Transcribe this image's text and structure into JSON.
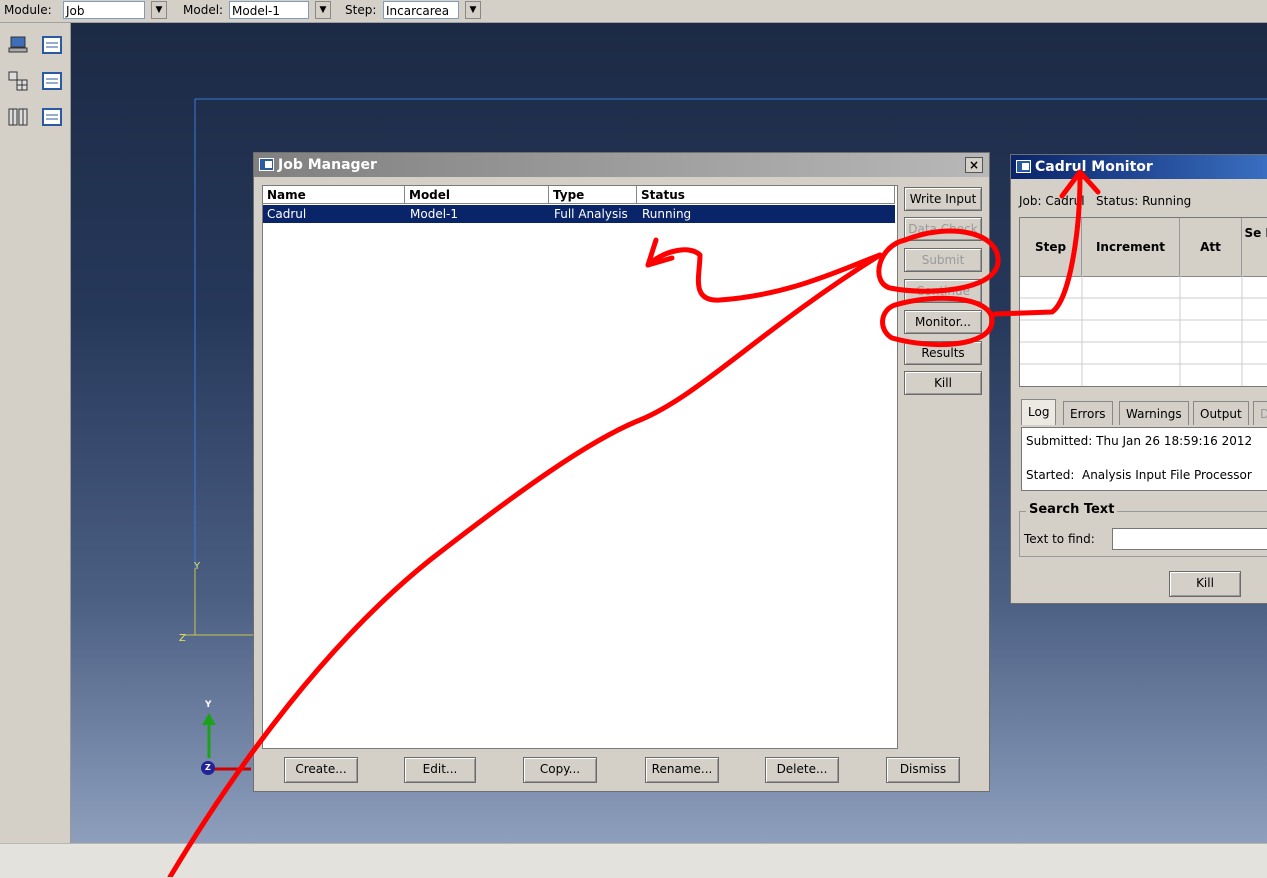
{
  "toolbar": {
    "module_label": "Module:",
    "module_value": "Job",
    "model_label": "Model:",
    "model_value": "Model-1",
    "step_label": "Step:",
    "step_value": "Incarcarea"
  },
  "viewport": {
    "csys_y": "Y",
    "csys_z": "Z",
    "triad_y": "Y",
    "triad_z": "Z"
  },
  "job_manager": {
    "title": "Job Manager",
    "close": "×",
    "columns": [
      "Name",
      "Model",
      "Type",
      "Status"
    ],
    "rows": [
      {
        "name": "Cadrul",
        "model": "Model-1",
        "type": "Full Analysis",
        "status": "Running"
      }
    ],
    "side_buttons": {
      "write_input": "Write Input",
      "data_check": "Data Check",
      "submit": "Submit",
      "continue": "Continue",
      "monitor": "Monitor...",
      "results": "Results",
      "kill": "Kill"
    },
    "bottom_buttons": {
      "create": "Create...",
      "edit": "Edit...",
      "copy": "Copy...",
      "rename": "Rename...",
      "delete": "Delete...",
      "dismiss": "Dismiss"
    }
  },
  "monitor": {
    "title": "Cadrul Monitor",
    "job_line": "Job: Cadrul   Status: Running",
    "columns": [
      "Step",
      "Increment",
      "Att",
      "Se Di"
    ],
    "tabs": [
      "Log",
      "Errors",
      "Warnings",
      "Output",
      "D"
    ],
    "log_lines": [
      "Submitted: Thu Jan 26 18:59:16 2012",
      "Started:  Analysis Input File Processor"
    ],
    "search_title": "Search Text",
    "find_label": "Text to find:",
    "kill": "Kill"
  },
  "colors": {
    "annotation": "#ff0000",
    "selection": "#0a246a",
    "title_active": "#0a246a",
    "title_inactive": "#808080"
  }
}
